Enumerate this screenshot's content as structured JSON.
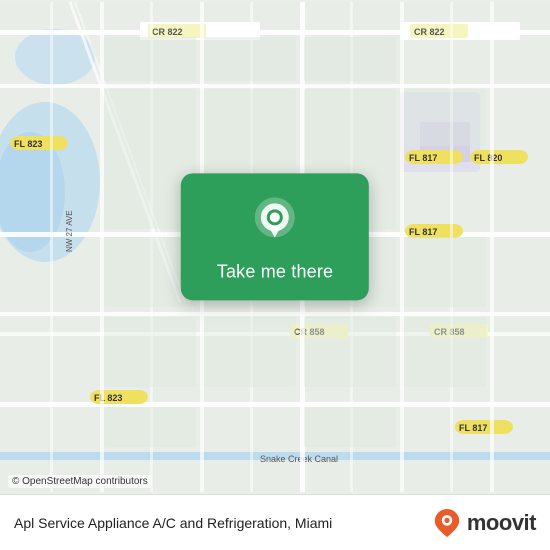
{
  "map": {
    "attribution": "© OpenStreetMap contributors",
    "center_lat": 25.85,
    "center_lng": -80.3
  },
  "location_card": {
    "button_label": "Take me there"
  },
  "bottom_bar": {
    "business_name": "Apl Service Appliance A/C and Refrigeration, Miami",
    "moovit_label": "moovit"
  },
  "icons": {
    "pin": "location-pin-icon",
    "moovit_pin": "moovit-pin-icon"
  },
  "colors": {
    "card_green": "#2e9e5b",
    "road_yellow": "#f5e642",
    "road_white": "#ffffff",
    "water_blue": "#b3d9f5",
    "land_light": "#e8f0e8"
  }
}
